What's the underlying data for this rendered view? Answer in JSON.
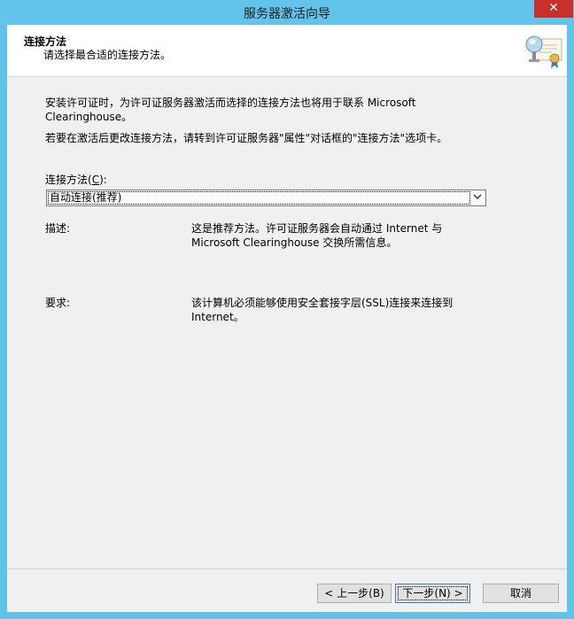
{
  "window": {
    "title": "服务器激活向导",
    "close_glyph": "✕"
  },
  "header": {
    "title": "连接方法",
    "subtitle": "请选择最合适的连接方法。",
    "icon": "certificate-icon"
  },
  "body": {
    "paragraph1": "安装许可证时，为许可证服务器激活而选择的连接方法也将用于联系 Microsoft Clearinghouse。",
    "paragraph2": "若要在激活后更改连接方法，请转到许可证服务器\"属性\"对话框的\"连接方法\"选项卡。",
    "connection_method": {
      "label_prefix": "连接方法(",
      "accel_key": "C",
      "label_suffix": "):",
      "selected": "自动连接(推荐)"
    },
    "description": {
      "label": "描述:",
      "text": "这是推荐方法。许可证服务器会自动通过 Internet 与 Microsoft Clearinghouse 交换所需信息。"
    },
    "requirements": {
      "label": "要求:",
      "text": "该计算机必须能够使用安全套接字层(SSL)连接来连接到 Internet。"
    }
  },
  "buttons": {
    "back": "< 上一步(B)",
    "next": "下一步(N) >",
    "cancel": "取消"
  }
}
